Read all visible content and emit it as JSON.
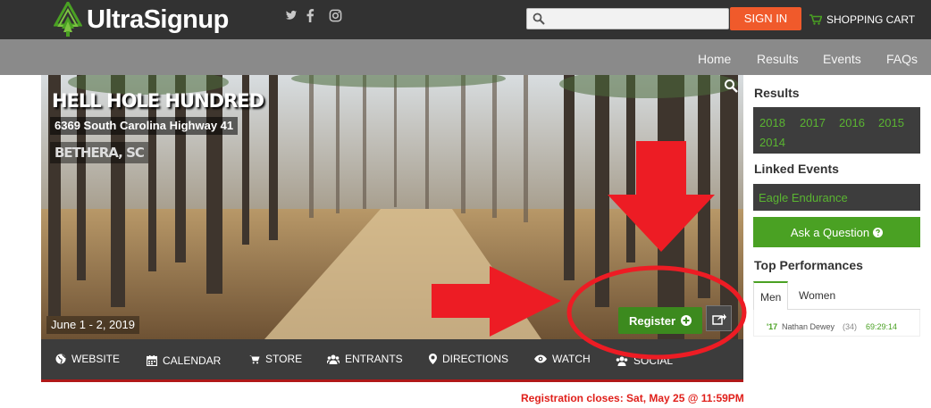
{
  "header": {
    "logo_text": "UltraSignup",
    "social_icons": [
      "twitter-icon",
      "facebook-icon",
      "instagram-icon"
    ],
    "search_placeholder": "",
    "signin_label": "SIGN IN",
    "cart_label": "SHOPPING CART"
  },
  "nav": {
    "items": [
      {
        "label": "Home"
      },
      {
        "label": "Results"
      },
      {
        "label": "Events"
      },
      {
        "label": "FAQs"
      }
    ]
  },
  "event": {
    "title": "HELL HOLE HUNDRED",
    "address": "6369 South Carolina Highway 41",
    "city": "BETHERA, SC",
    "dates": "June 1 - 2, 2019",
    "register_label": "Register",
    "registration_closes": "Registration closes: Sat, May 25 @ 11:59PM"
  },
  "event_nav": {
    "items": [
      {
        "label": "WEBSITE",
        "icon": "globe-icon"
      },
      {
        "label": "CALENDAR",
        "icon": "calendar-icon"
      },
      {
        "label": "STORE",
        "icon": "cart-icon"
      },
      {
        "label": "ENTRANTS",
        "icon": "users-icon"
      },
      {
        "label": "DIRECTIONS",
        "icon": "map-marker-icon"
      },
      {
        "label": "WATCH",
        "icon": "eye-icon"
      },
      {
        "label": "SOCIAL",
        "icon": "users-icon"
      }
    ]
  },
  "sidebar": {
    "results_heading": "Results",
    "years": [
      "2018",
      "2017",
      "2016",
      "2015",
      "2014"
    ],
    "linked_heading": "Linked Events",
    "linked_events": [
      "Eagle Endurance"
    ],
    "ask_label": "Ask a Question",
    "top_heading": "Top Performances",
    "tabs": [
      "Men",
      "Women"
    ],
    "performances": [
      {
        "year": "'17",
        "name": "Nathan Dewey",
        "age": "(34)",
        "time": "69:29:14"
      }
    ]
  },
  "colors": {
    "accent_green": "#4aa123",
    "signin_orange": "#f05a2b",
    "annotation_red": "#ed1c24",
    "header_dark": "#323232"
  }
}
